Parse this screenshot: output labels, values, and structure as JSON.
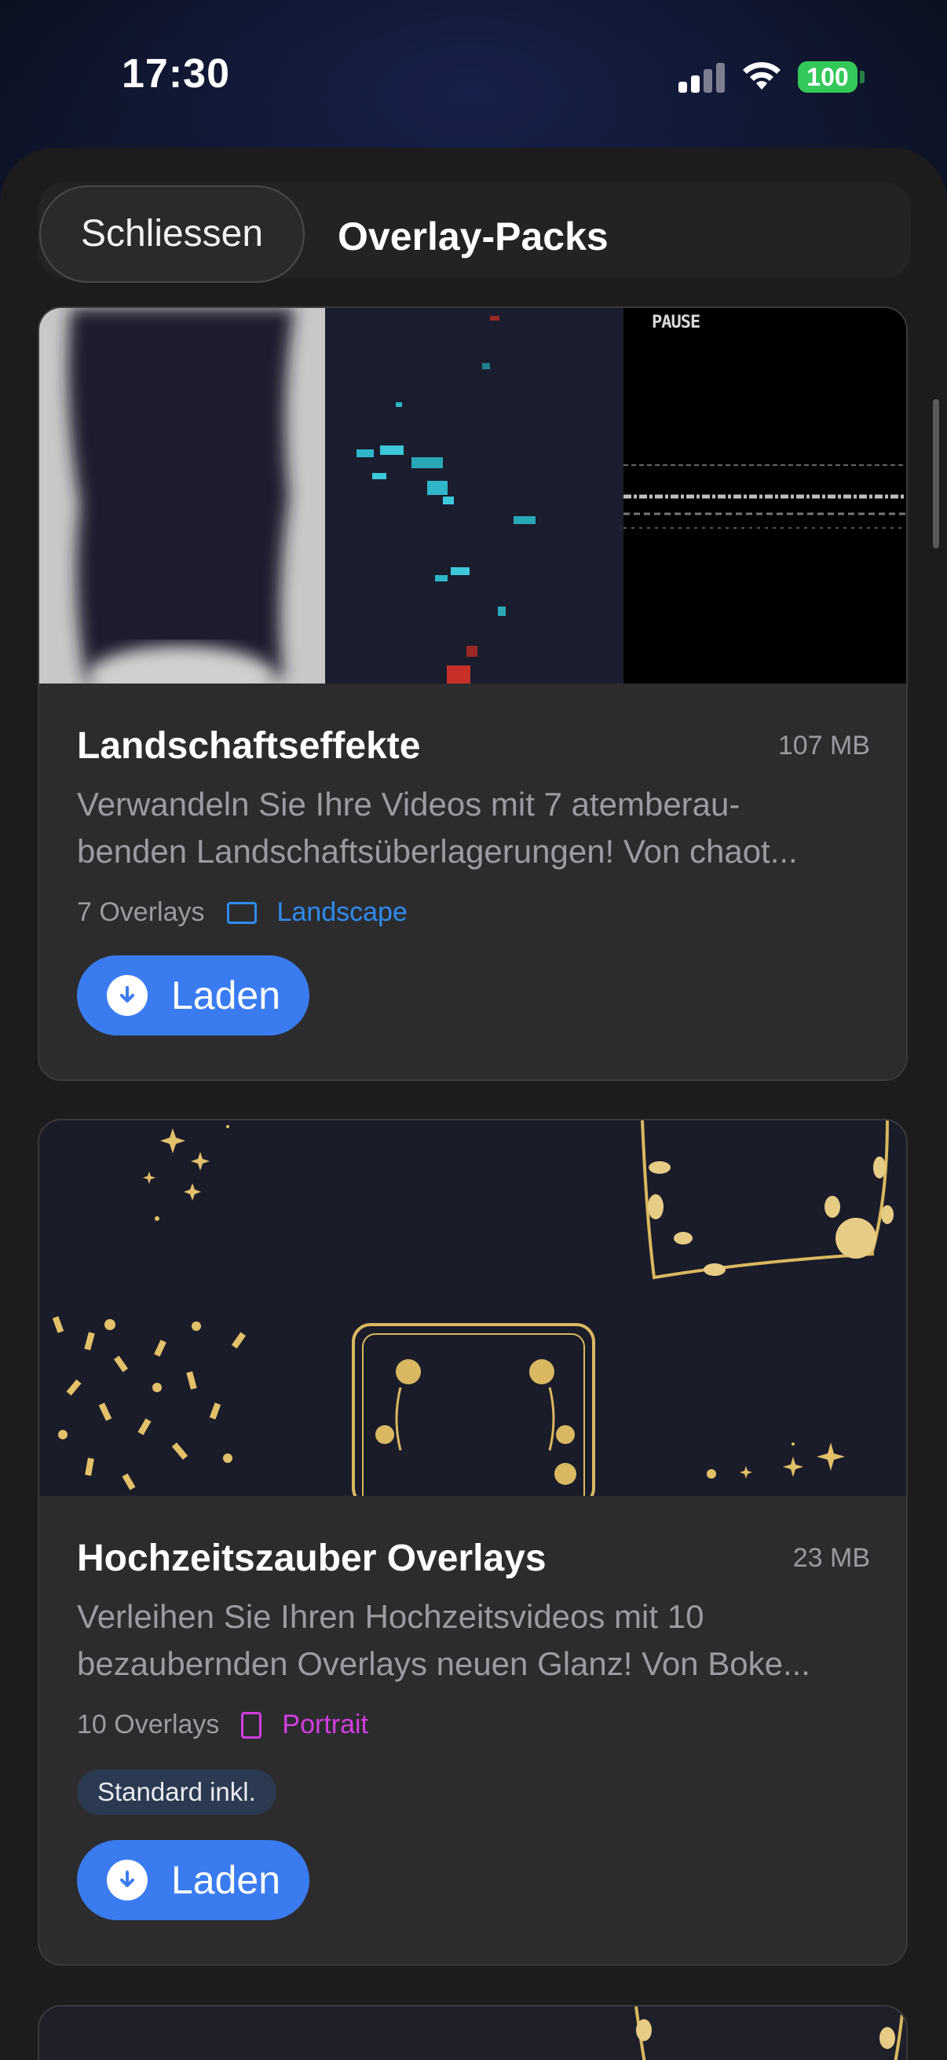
{
  "status_bar": {
    "time": "17:30",
    "battery": "100"
  },
  "sheet": {
    "close_label": "Schliessen",
    "title": "Overlay-Packs"
  },
  "packs": [
    {
      "title": "Landschaftseffekte",
      "size": "107 MB",
      "description_line1": "Verwandeln Sie Ihre Videos mit 7 atemberau-",
      "description_line2": "benden Landschaftsüberlagerungen! Von chaot...",
      "overlay_count": "7 Overlays",
      "orientation": "Landscape",
      "orientation_color": "#2f8cf0",
      "thumbnail_texts": [
        "PAUSE"
      ],
      "load_label": "Laden"
    },
    {
      "title": "Hochzeitszauber Overlays",
      "size": "23 MB",
      "description_line1": "Verleihen Sie Ihren Hochzeitsvideos mit 10",
      "description_line2": "bezaubernden Overlays neuen Glanz! Von Boke...",
      "overlay_count": "10 Overlays",
      "orientation": "Portrait",
      "orientation_color": "#d23ee0",
      "badge": "Standard inkl.",
      "load_label": "Laden"
    }
  ],
  "colors": {
    "accent": "#3a7cf0",
    "sheet_bg": "#1c1c1e",
    "card_bg": "#2c2c2e",
    "battery": "#34c759",
    "gold": "#e3c16a"
  }
}
